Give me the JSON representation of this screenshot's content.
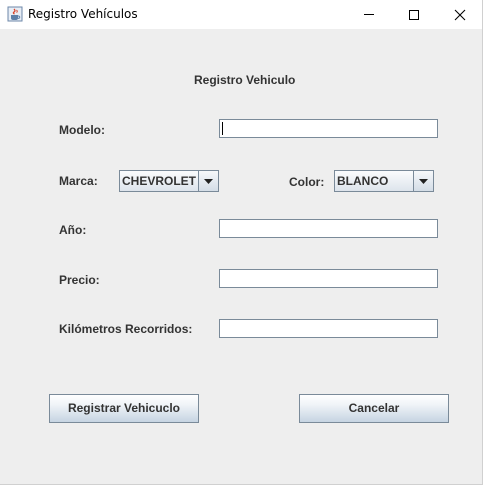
{
  "window": {
    "title": "Registro Vehículos"
  },
  "form": {
    "heading": "Registro Vehiculo",
    "modelo_label": "Modelo:",
    "modelo_value": "",
    "marca_label": "Marca:",
    "marca_selected": "CHEVROLET",
    "color_label": "Color:",
    "color_selected": "BLANCO",
    "anio_label": "Año:",
    "anio_value": "",
    "precio_label": "Precio:",
    "precio_value": "",
    "km_label": "Kilómetros Recorridos:",
    "km_value": ""
  },
  "buttons": {
    "register_label": "Registrar Vehicuclo",
    "cancel_label": "Cancelar"
  },
  "icons": {
    "app": "java-cup-icon",
    "minimize": "minimize-icon",
    "maximize": "maximize-icon",
    "close": "close-icon",
    "dropdown": "chevron-down-icon"
  },
  "colors": {
    "window_bg": "#eeeeee",
    "titlebar_bg": "#ffffff",
    "label_text": "#333333",
    "border": "#7a8a99"
  }
}
